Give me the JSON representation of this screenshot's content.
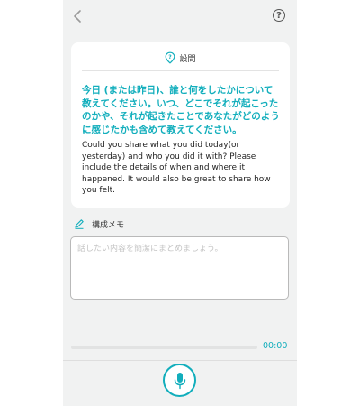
{
  "header": {
    "back_icon": "chevron-left-icon",
    "help_icon": "question-circle-icon"
  },
  "question_card": {
    "icon": "location-question-icon",
    "label": "設問",
    "text_ja": "今日 (または昨日)、誰と何をしたかについて教えてください。いつ、どこでそれが起こったのかや、それが起きたことであなたがどのように感じたかも含めて教えてください。",
    "text_en": "Could you share what you did today(or yesterday) and who you did it with? Please include the details of when and where it happened. It would also be great to share how you felt."
  },
  "memo": {
    "icon": "pencil-icon",
    "label": "構成メモ",
    "value": "",
    "placeholder": "話したい内容を簡潔にまとめましょう。"
  },
  "player": {
    "progress": 0,
    "time": "00:00"
  },
  "record": {
    "icon": "microphone-icon"
  },
  "colors": {
    "accent": "#12aebc",
    "background": "#f1f2f2",
    "card": "#ffffff"
  }
}
